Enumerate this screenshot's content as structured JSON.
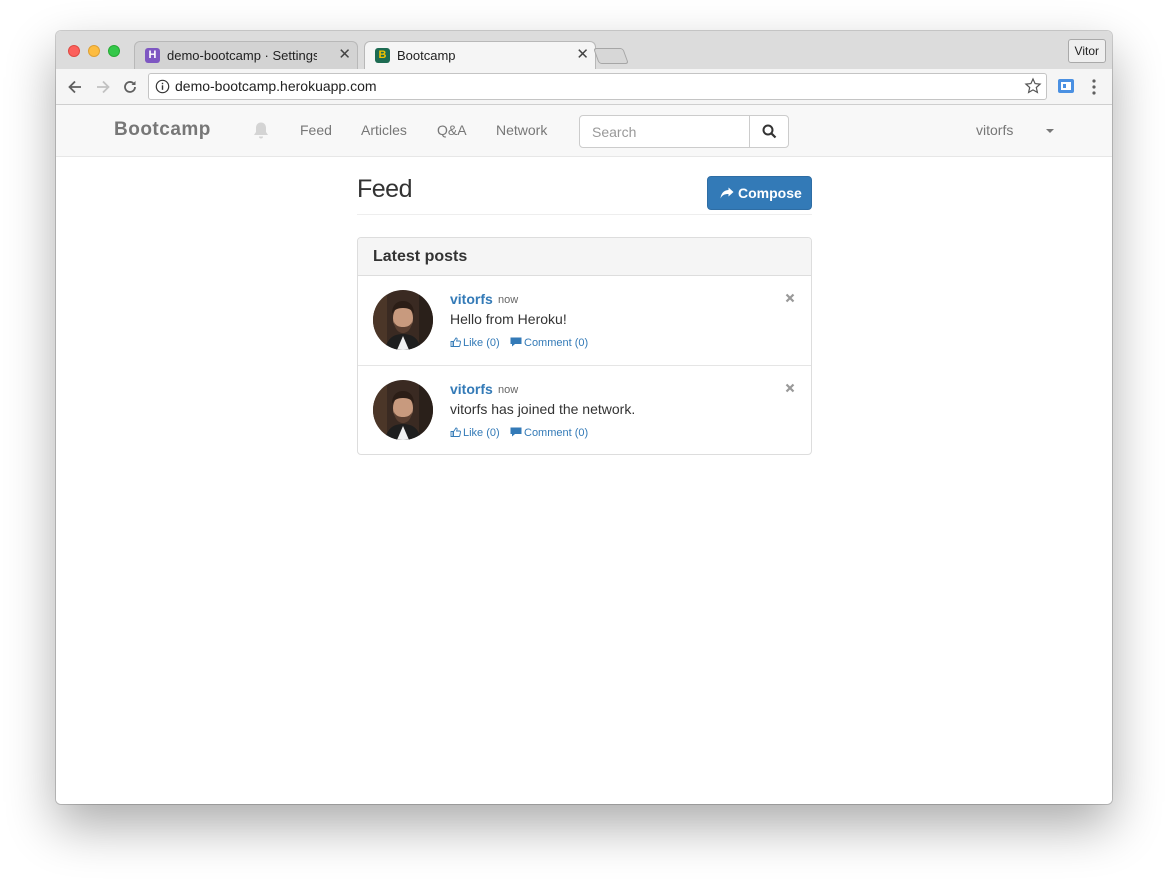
{
  "browser": {
    "tabs": [
      {
        "label": "demo-bootcamp · Settings | Heroku",
        "favicon": "H"
      },
      {
        "label": "Bootcamp",
        "favicon": "B"
      }
    ],
    "profile_label": "Vitor",
    "url": "demo-bootcamp.herokuapp.com"
  },
  "site": {
    "brand": "Bootcamp",
    "nav": [
      "Feed",
      "Articles",
      "Q&A",
      "Network"
    ],
    "search_placeholder": "Search",
    "user": "vitorfs"
  },
  "main": {
    "title": "Feed",
    "compose_label": "Compose",
    "panel_title": "Latest posts",
    "posts": [
      {
        "author": "vitorfs",
        "time": "now",
        "text": "Hello from Heroku!",
        "like": "Like (0)",
        "comment": "Comment (0)"
      },
      {
        "author": "vitorfs",
        "time": "now",
        "text": "vitorfs has joined the network.",
        "like": "Like (0)",
        "comment": "Comment (0)"
      }
    ]
  },
  "colors": {
    "link": "#337ab7",
    "primary_button": "#337ab7",
    "navbar_bg": "#f8f8f8"
  }
}
